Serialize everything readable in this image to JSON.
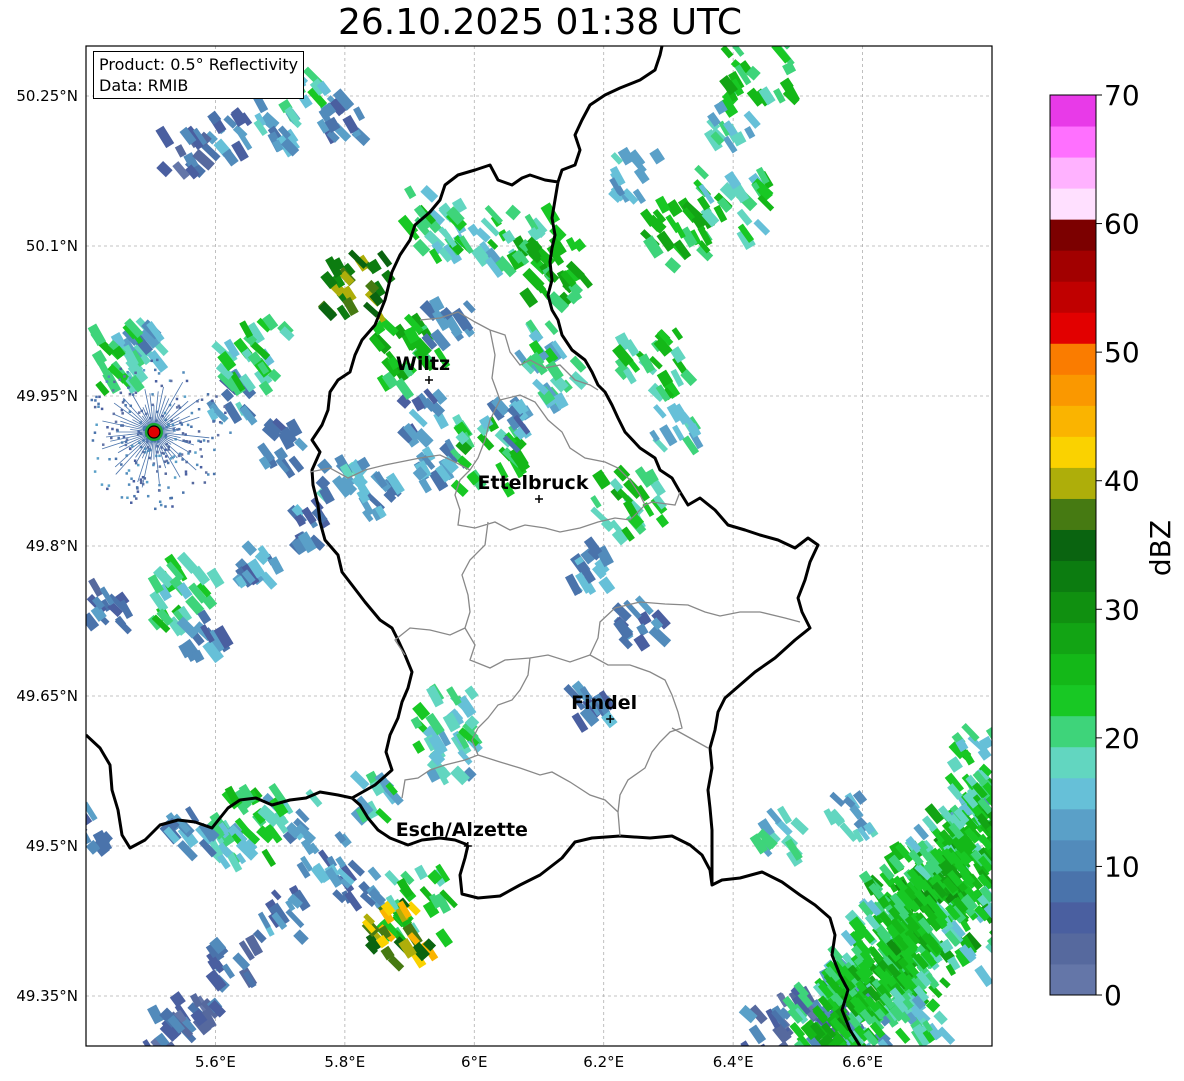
{
  "title": "26.10.2025 01:38 UTC",
  "info": {
    "product": "Product: 0.5° Reflectivity",
    "data": "Data: RMIB"
  },
  "map": {
    "lon_range": [
      5.4,
      6.8
    ],
    "lat_range": [
      49.3,
      50.3
    ],
    "lat_ticks": [
      {
        "v": 50.25,
        "label": "50.25°N"
      },
      {
        "v": 50.1,
        "label": "50.1°N"
      },
      {
        "v": 49.95,
        "label": "49.95°N"
      },
      {
        "v": 49.8,
        "label": "49.8°N"
      },
      {
        "v": 49.65,
        "label": "49.65°N"
      },
      {
        "v": 49.5,
        "label": "49.5°N"
      },
      {
        "v": 49.35,
        "label": "49.35°N"
      }
    ],
    "lon_ticks": [
      {
        "v": 5.6,
        "label": "5.6°E"
      },
      {
        "v": 5.8,
        "label": "5.8°E"
      },
      {
        "v": 6.0,
        "label": "6°E"
      },
      {
        "v": 6.2,
        "label": "6.2°E"
      },
      {
        "v": 6.4,
        "label": "6.4°E"
      },
      {
        "v": 6.6,
        "label": "6.6°E"
      }
    ],
    "cities": [
      {
        "name": "Wiltz",
        "lon": 5.93,
        "lat": 49.966
      },
      {
        "name": "Ettelbruck",
        "lon": 6.1,
        "lat": 49.847
      },
      {
        "name": "Findel",
        "lon": 6.21,
        "lat": 49.627
      },
      {
        "name": "Esch/Alzette",
        "lon": 5.99,
        "lat": 49.5
      }
    ],
    "radar_site": {
      "lon": 5.505,
      "lat": 49.914,
      "color": "#e00000"
    }
  },
  "colorbar": {
    "label": "dBZ",
    "min": 0,
    "max": 70,
    "ticks": [
      0,
      10,
      20,
      30,
      40,
      50,
      60,
      70
    ],
    "colors": [
      "#6476a8",
      "#56699e",
      "#4a5fa0",
      "#4a73ab",
      "#528bbb",
      "#5aa0c8",
      "#66c0d8",
      "#62d6c0",
      "#3ed47a",
      "#18c824",
      "#14b818",
      "#12a414",
      "#109010",
      "#0c7c10",
      "#0a6410",
      "#467a12",
      "#aeae0a",
      "#fad200",
      "#fab400",
      "#fa9800",
      "#fa7c00",
      "#e20000",
      "#c00000",
      "#a20000",
      "#7c0000",
      "#ffe0ff",
      "#ffb2ff",
      "#ff70ff",
      "#e83ae8"
    ]
  },
  "chart_data": {
    "type": "heatmap",
    "title": "26.10.2025 01:38 UTC",
    "xlabel": "",
    "ylabel": "",
    "xlim": [
      5.4,
      6.8
    ],
    "ylim": [
      49.3,
      50.3
    ],
    "colorbar_label": "dBZ",
    "colorbar_range": [
      0,
      70
    ],
    "grid": true,
    "reflectivity_cells": [
      {
        "lon": 6.55,
        "lat": 49.32,
        "dbz": 8
      },
      {
        "lon": 6.58,
        "lat": 49.36,
        "dbz": 12
      },
      {
        "lon": 6.62,
        "lat": 49.4,
        "dbz": 22
      },
      {
        "lon": 6.66,
        "lat": 49.44,
        "dbz": 24
      },
      {
        "lon": 6.7,
        "lat": 49.47,
        "dbz": 26
      },
      {
        "lon": 6.74,
        "lat": 49.5,
        "dbz": 22
      },
      {
        "lon": 6.78,
        "lat": 49.54,
        "dbz": 16
      },
      {
        "lon": 6.64,
        "lat": 49.34,
        "dbz": 20
      },
      {
        "lon": 6.68,
        "lat": 49.38,
        "dbz": 24
      },
      {
        "lon": 6.72,
        "lat": 49.42,
        "dbz": 26
      },
      {
        "lon": 6.76,
        "lat": 49.46,
        "dbz": 22
      },
      {
        "lon": 6.5,
        "lat": 49.33,
        "dbz": 6
      },
      {
        "lon": 6.45,
        "lat": 49.31,
        "dbz": 8
      },
      {
        "lon": 6.6,
        "lat": 49.31,
        "dbz": 14
      },
      {
        "lon": 6.7,
        "lat": 49.33,
        "dbz": 18
      },
      {
        "lon": 6.78,
        "lat": 49.4,
        "dbz": 20
      },
      {
        "lon": 5.62,
        "lat": 50.21,
        "dbz": 10
      },
      {
        "lon": 5.7,
        "lat": 50.22,
        "dbz": 14
      },
      {
        "lon": 5.74,
        "lat": 50.25,
        "dbz": 18
      },
      {
        "lon": 5.55,
        "lat": 50.19,
        "dbz": 6
      },
      {
        "lon": 5.8,
        "lat": 50.23,
        "dbz": 10
      },
      {
        "lon": 5.48,
        "lat": 50.0,
        "dbz": 14
      },
      {
        "lon": 5.43,
        "lat": 49.99,
        "dbz": 22
      },
      {
        "lon": 5.62,
        "lat": 49.95,
        "dbz": 12
      },
      {
        "lon": 5.66,
        "lat": 49.99,
        "dbz": 20
      },
      {
        "lon": 5.7,
        "lat": 49.9,
        "dbz": 10
      },
      {
        "lon": 5.8,
        "lat": 49.87,
        "dbz": 14
      },
      {
        "lon": 5.85,
        "lat": 49.85,
        "dbz": 12
      },
      {
        "lon": 5.75,
        "lat": 49.82,
        "dbz": 10
      },
      {
        "lon": 5.95,
        "lat": 49.88,
        "dbz": 12
      },
      {
        "lon": 6.02,
        "lat": 49.89,
        "dbz": 22
      },
      {
        "lon": 5.92,
        "lat": 49.93,
        "dbz": 10
      },
      {
        "lon": 5.9,
        "lat": 49.99,
        "dbz": 24
      },
      {
        "lon": 5.82,
        "lat": 50.06,
        "dbz": 36
      },
      {
        "lon": 6.08,
        "lat": 50.1,
        "dbz": 22
      },
      {
        "lon": 6.12,
        "lat": 50.07,
        "dbz": 24
      },
      {
        "lon": 6.0,
        "lat": 50.1,
        "dbz": 18
      },
      {
        "lon": 5.95,
        "lat": 50.12,
        "dbz": 20
      },
      {
        "lon": 6.1,
        "lat": 50.0,
        "dbz": 18
      },
      {
        "lon": 6.13,
        "lat": 49.96,
        "dbz": 16
      },
      {
        "lon": 6.05,
        "lat": 49.92,
        "dbz": 12
      },
      {
        "lon": 6.4,
        "lat": 50.22,
        "dbz": 18
      },
      {
        "lon": 6.44,
        "lat": 50.28,
        "dbz": 22
      },
      {
        "lon": 6.32,
        "lat": 50.11,
        "dbz": 24
      },
      {
        "lon": 6.28,
        "lat": 49.98,
        "dbz": 22
      },
      {
        "lon": 6.31,
        "lat": 49.92,
        "dbz": 18
      },
      {
        "lon": 6.4,
        "lat": 50.14,
        "dbz": 20
      },
      {
        "lon": 6.25,
        "lat": 50.17,
        "dbz": 16
      },
      {
        "lon": 6.24,
        "lat": 49.84,
        "dbz": 22
      },
      {
        "lon": 6.18,
        "lat": 49.78,
        "dbz": 12
      },
      {
        "lon": 6.18,
        "lat": 49.64,
        "dbz": 10
      },
      {
        "lon": 6.26,
        "lat": 49.72,
        "dbz": 8
      },
      {
        "lon": 5.97,
        "lat": 49.59,
        "dbz": 16
      },
      {
        "lon": 5.95,
        "lat": 49.62,
        "dbz": 20
      },
      {
        "lon": 5.85,
        "lat": 49.55,
        "dbz": 18
      },
      {
        "lon": 5.91,
        "lat": 49.44,
        "dbz": 22
      },
      {
        "lon": 5.88,
        "lat": 49.41,
        "dbz": 40
      },
      {
        "lon": 5.82,
        "lat": 49.46,
        "dbz": 10
      },
      {
        "lon": 5.77,
        "lat": 49.49,
        "dbz": 12
      },
      {
        "lon": 5.72,
        "lat": 49.53,
        "dbz": 14
      },
      {
        "lon": 5.62,
        "lat": 49.5,
        "dbz": 18
      },
      {
        "lon": 5.65,
        "lat": 49.52,
        "dbz": 20
      },
      {
        "lon": 5.56,
        "lat": 49.51,
        "dbz": 12
      },
      {
        "lon": 5.44,
        "lat": 49.74,
        "dbz": 8
      },
      {
        "lon": 5.55,
        "lat": 49.75,
        "dbz": 20
      },
      {
        "lon": 5.58,
        "lat": 49.71,
        "dbz": 10
      },
      {
        "lon": 5.67,
        "lat": 49.78,
        "dbz": 12
      },
      {
        "lon": 5.4,
        "lat": 49.52,
        "dbz": 10
      },
      {
        "lon": 6.47,
        "lat": 49.51,
        "dbz": 16
      },
      {
        "lon": 6.58,
        "lat": 49.53,
        "dbz": 14
      },
      {
        "lon": 6.79,
        "lat": 49.58,
        "dbz": 20
      },
      {
        "lon": 5.57,
        "lat": 49.34,
        "dbz": 6
      },
      {
        "lon": 5.53,
        "lat": 49.31,
        "dbz": 6
      },
      {
        "lon": 5.63,
        "lat": 49.38,
        "dbz": 8
      },
      {
        "lon": 5.7,
        "lat": 49.43,
        "dbz": 10
      },
      {
        "lon": 5.96,
        "lat": 50.02,
        "dbz": 12
      }
    ]
  }
}
